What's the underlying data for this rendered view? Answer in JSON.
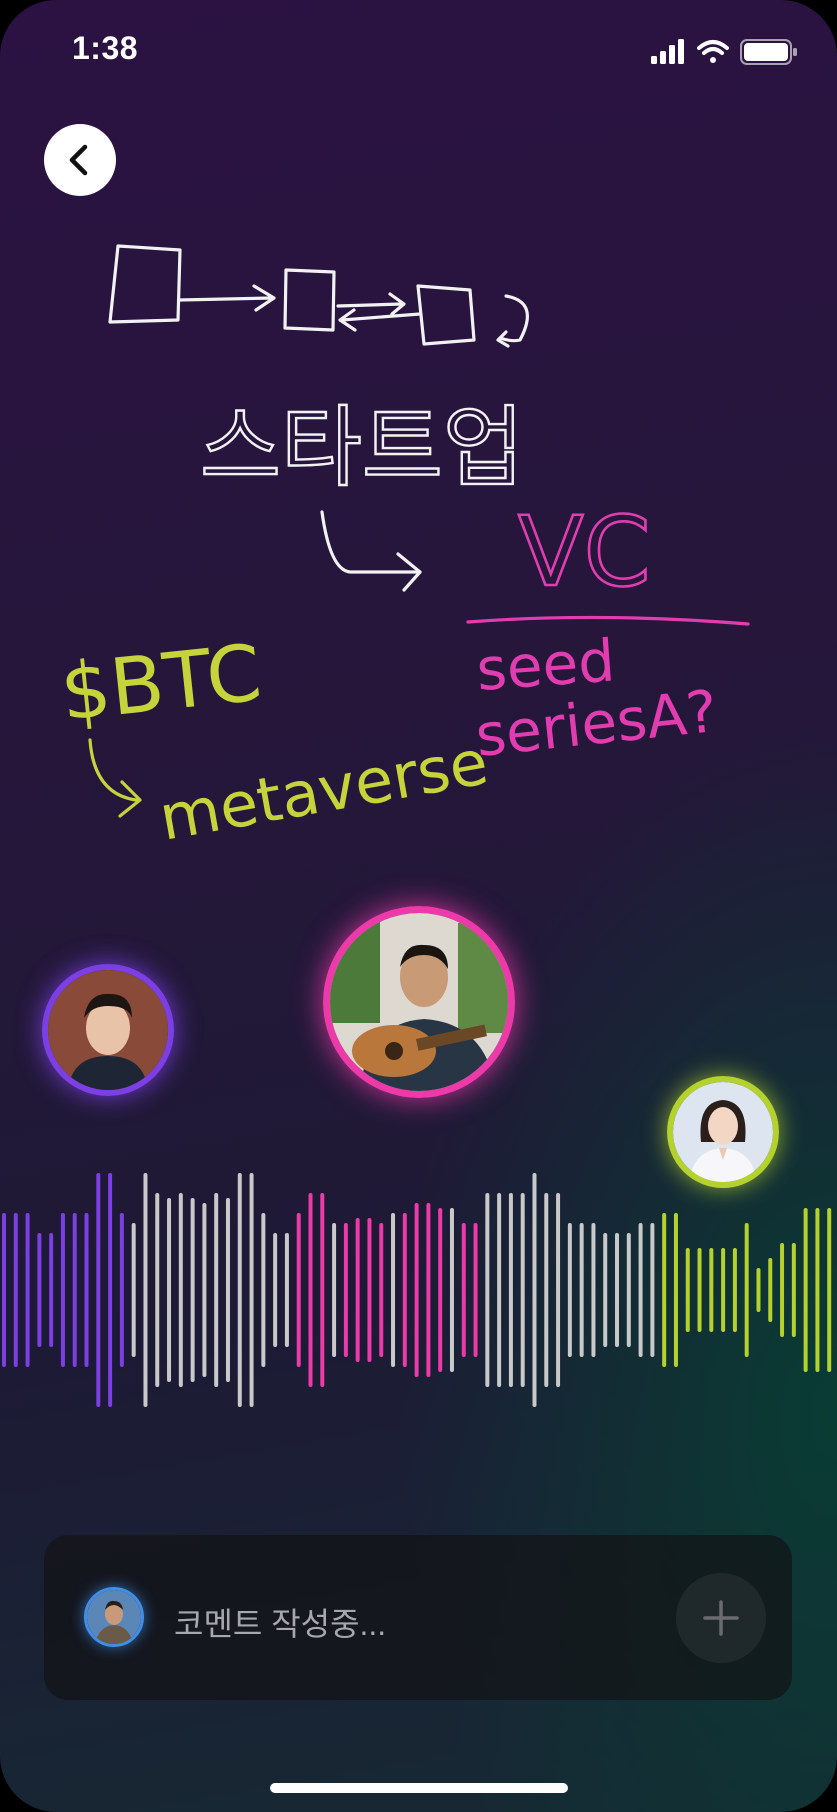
{
  "status_bar": {
    "time": "1:38"
  },
  "whiteboard": {
    "korean_note": "스타트업",
    "vc_note": "VC",
    "seed_note": "seed",
    "series_note": "seriesA?",
    "btc_note": "$BTC",
    "metaverse_note": "metaverse"
  },
  "colors": {
    "speaker_1": "#7b3fe4",
    "speaker_2": "#ec3aa9",
    "speaker_3": "#b5d12d",
    "neutral_wave": "#c9c9c9"
  },
  "comment": {
    "placeholder": "코멘트 작성중..."
  }
}
